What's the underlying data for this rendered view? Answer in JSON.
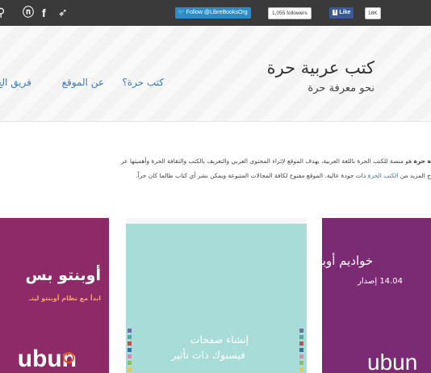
{
  "topbar": {
    "twitter_follow": "Follow @LibreBooksOrg",
    "twitter_count": "1,055 followers",
    "fb_like": "Like",
    "fb_count": "18K",
    "colors": {
      "bar": "#3a3a3a",
      "twitter": "#2a8cc8",
      "facebook": "#3b5998"
    }
  },
  "header": {
    "site_title": "كتب عربية حرة",
    "tagline": "نحو معرفة حرة",
    "nav": [
      "كتب حرة؟",
      "عن الموقع",
      "فريق الع"
    ]
  },
  "intro": {
    "line1_bold": "ة حرة",
    "line1_rest": " هو منصة للكتب الحرة باللغة العربية، يهدف الموقع لإثراء المحتوى العربي والتعريف بالكتب والثقافة الحرة وأهميتها عر",
    "line2_start": "ج المزيد من ",
    "line2_link": "الكتب الحرة",
    "line2_rest": " ذات جودة عالية. الموقع مفتوح لكافة المجالات المتنوعة ويمكن نشر أي كتاب طالما كان حراً."
  },
  "books": [
    {
      "title": "أوبنتو بس",
      "subtitle": "ابدأ مع نظام أوبنتو لينـ",
      "logo": "ubun",
      "color": "#8e2a67"
    },
    {
      "title_line1": "إنشاء صفحات",
      "title_line2": "فيسبوك ذات تأثير",
      "color": "#a7dcd8"
    },
    {
      "title": "خواديم أوبنتو",
      "subtitle": "14.04 إصدار",
      "logo": "ubun",
      "color": "#7b2b74"
    }
  ]
}
